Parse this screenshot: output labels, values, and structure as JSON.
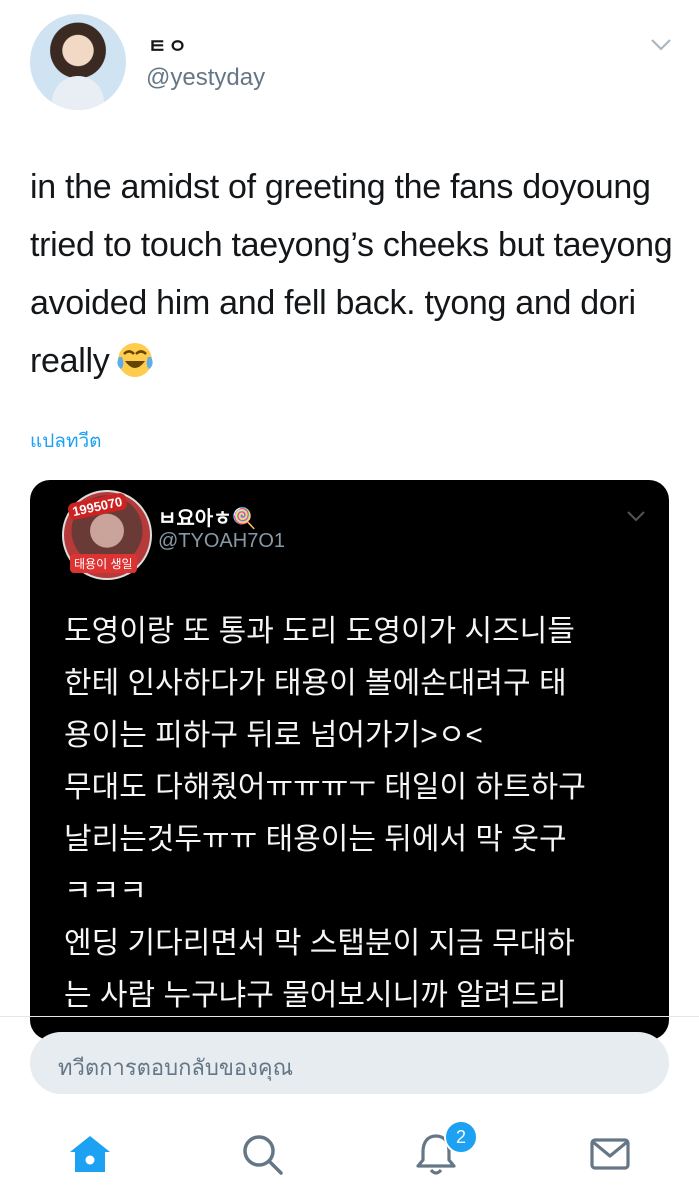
{
  "tweet": {
    "display_name": "ㅌㅇ",
    "handle": "@yestyday",
    "text": "in the amidst of greeting the fans doyoung tried to touch taeyong’s cheeks but taeyong avoided him and fell back. tyong and dori really",
    "emoji": "face-with-tears-of-joy",
    "translate_label": "แปลทวีต"
  },
  "quoted": {
    "display_name": "ㅂ요아ㅎ🍭",
    "handle": "@TYOAH7O1",
    "avatar_badge_top": "1995070",
    "avatar_badge_bottom": "태용이 생일",
    "text": "도영이랑 또 통과 도리 도영이가 시즈니들\n한테 인사하다가 태용이 볼에손대려구 태\n용이는 피하구 뒤로 넘어가기>ㅇ<\n무대도 다해줬어ㅠㅠㅠㅜ 태일이 하트하구\n날리는것두ㅠㅠ 태용이는 뒤에서 막 웃구\nㅋㅋㅋ\n엔딩 기다리면서 막 스탭분이 지금 무대하\n는 사람 누구냐구 물어보시니까 알려드리"
  },
  "reply": {
    "placeholder": "ทวีตการตอบกลับของคุณ"
  },
  "nav": {
    "items": [
      "home-icon",
      "search-icon",
      "notifications-icon",
      "messages-icon"
    ],
    "notification_count": "2"
  },
  "colors": {
    "accent": "#1da1f2",
    "quote_bg": "#000000",
    "reply_bg": "#e6ecf0"
  }
}
